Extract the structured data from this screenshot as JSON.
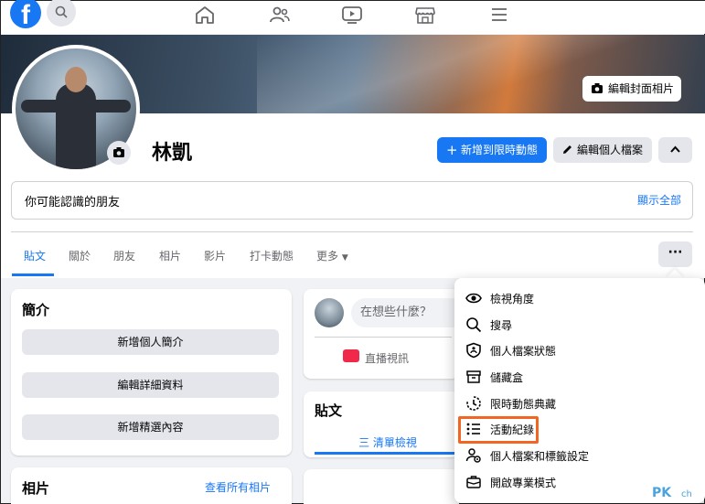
{
  "nav": {
    "logo": "f"
  },
  "cover": {
    "edit_cover_label": "編輯封面相片"
  },
  "profile": {
    "name": "林凱",
    "add_story_label": "新增到限時動態",
    "edit_profile_label": "編輯個人檔案"
  },
  "friends": {
    "title": "你可能認識的朋友",
    "see_all": "顯示全部"
  },
  "tabs": [
    {
      "label": "貼文"
    },
    {
      "label": "關於"
    },
    {
      "label": "朋友"
    },
    {
      "label": "相片"
    },
    {
      "label": "影片"
    },
    {
      "label": "打卡動態"
    },
    {
      "label": "更多"
    }
  ],
  "more_button": "···",
  "intro": {
    "title": "簡介",
    "buttons": [
      "新增個人簡介",
      "編輯詳細資料",
      "新增精選內容"
    ]
  },
  "photos": {
    "title": "相片",
    "see_all": "查看所有相片"
  },
  "composer": {
    "placeholder": "在想些什麼？",
    "live_label": "直播視訊"
  },
  "posts": {
    "title": "貼文",
    "list_view": "三 清單檢視"
  },
  "menu": {
    "items": [
      {
        "label": "檢視角度",
        "icon": "eye-icon"
      },
      {
        "label": "搜尋",
        "icon": "search-icon"
      },
      {
        "label": "個人檔案狀態",
        "icon": "shield-icon"
      },
      {
        "label": "儲藏盒",
        "icon": "archive-box-icon"
      },
      {
        "label": "限時動態典藏",
        "icon": "story-archive-icon"
      },
      {
        "label": "活動紀錄",
        "icon": "list-icon"
      },
      {
        "label": "個人檔案和標籤設定",
        "icon": "profile-settings-icon"
      },
      {
        "label": "開啟專業模式",
        "icon": "briefcase-icon"
      }
    ],
    "highlight_color": "#f26522"
  },
  "watermark": {
    "text": "PK",
    "suffix": "ch"
  },
  "colors": {
    "accent": "#1877f2",
    "highlight": "#f26522"
  }
}
